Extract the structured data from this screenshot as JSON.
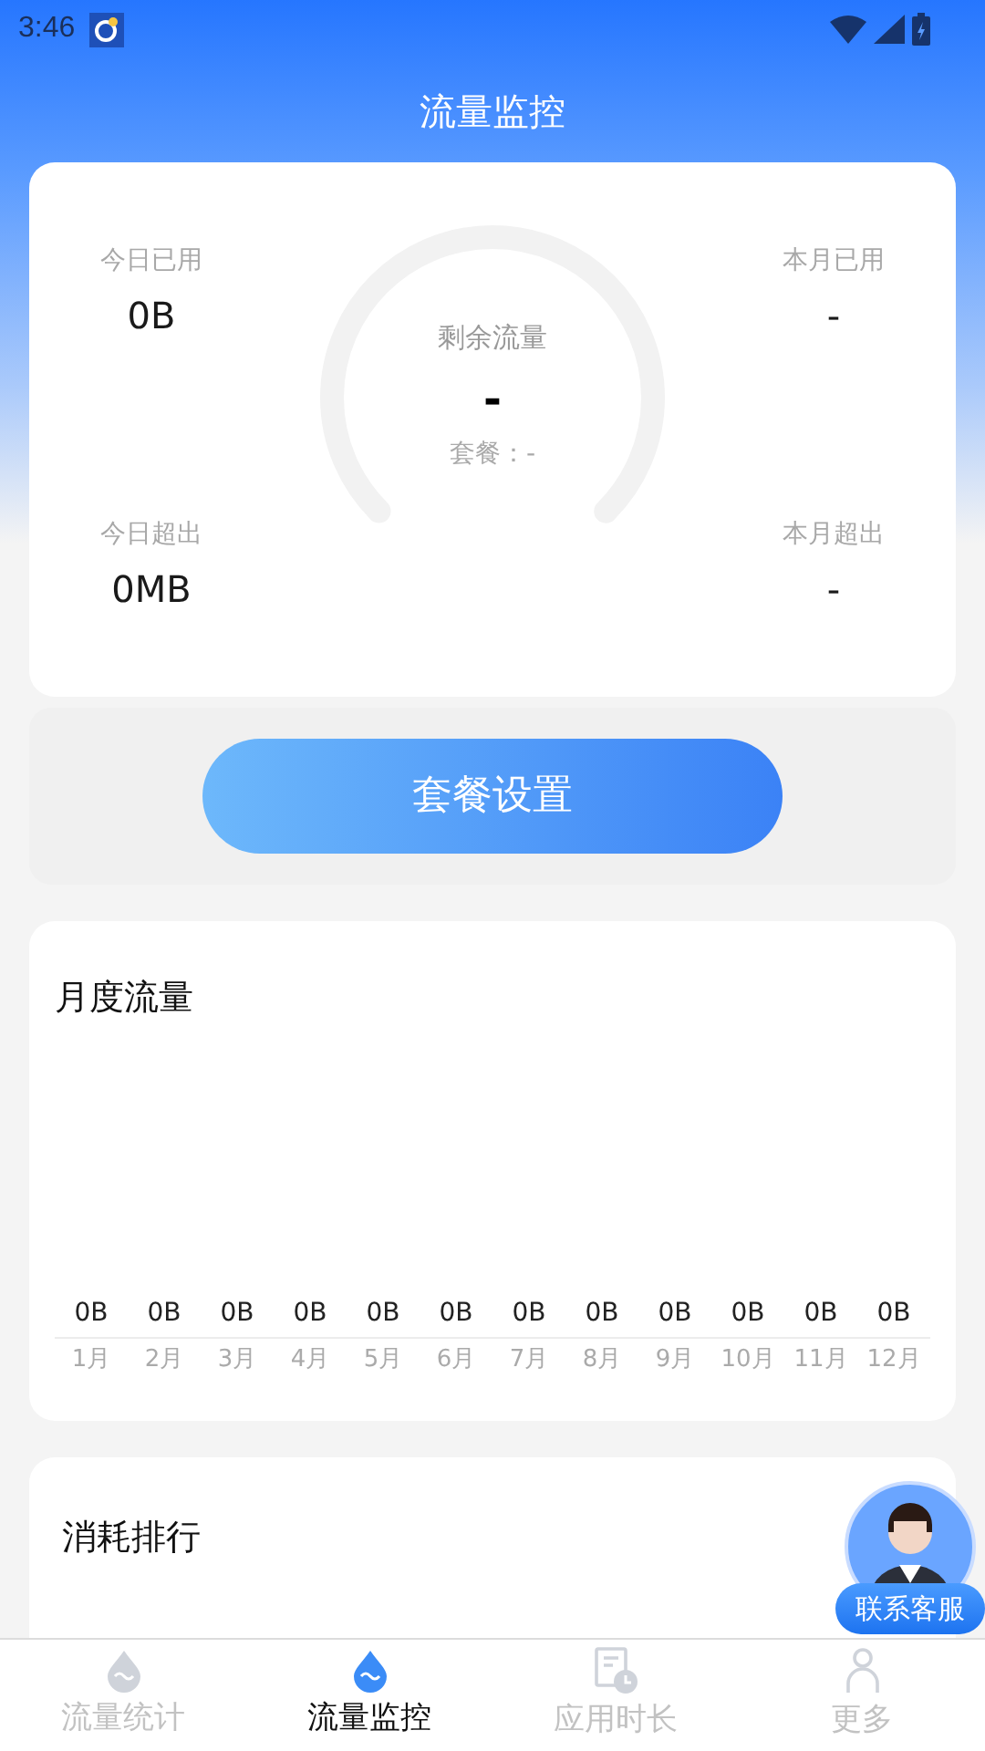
{
  "status_bar": {
    "time": "3:46"
  },
  "header": {
    "title": "流量监控"
  },
  "summary": {
    "today_used": {
      "label": "今日已用",
      "value": "0B"
    },
    "month_used": {
      "label": "本月已用",
      "value": "-"
    },
    "today_over": {
      "label": "今日超出",
      "value": "0MB"
    },
    "month_over": {
      "label": "本月超出",
      "value": "-"
    },
    "gauge": {
      "label": "剩余流量",
      "value": "-",
      "plan": "套餐：-"
    }
  },
  "plan_button": "套餐设置",
  "monthly": {
    "title": "月度流量",
    "months": [
      {
        "value": "0B",
        "label": "1月"
      },
      {
        "value": "0B",
        "label": "2月"
      },
      {
        "value": "0B",
        "label": "3月"
      },
      {
        "value": "0B",
        "label": "4月"
      },
      {
        "value": "0B",
        "label": "5月"
      },
      {
        "value": "0B",
        "label": "6月"
      },
      {
        "value": "0B",
        "label": "7月"
      },
      {
        "value": "0B",
        "label": "8月"
      },
      {
        "value": "0B",
        "label": "9月"
      },
      {
        "value": "0B",
        "label": "10月"
      },
      {
        "value": "0B",
        "label": "11月"
      },
      {
        "value": "0B",
        "label": "12月"
      }
    ]
  },
  "ranking": {
    "title": "消耗排行"
  },
  "support_button": "联系客服",
  "tabs": [
    {
      "label": "流量统计",
      "kind": "drop",
      "selected": false
    },
    {
      "label": "流量监控",
      "kind": "drop",
      "selected": true
    },
    {
      "label": "应用时长",
      "kind": "clock",
      "selected": false
    },
    {
      "label": "更多",
      "kind": "person",
      "selected": false
    }
  ]
}
